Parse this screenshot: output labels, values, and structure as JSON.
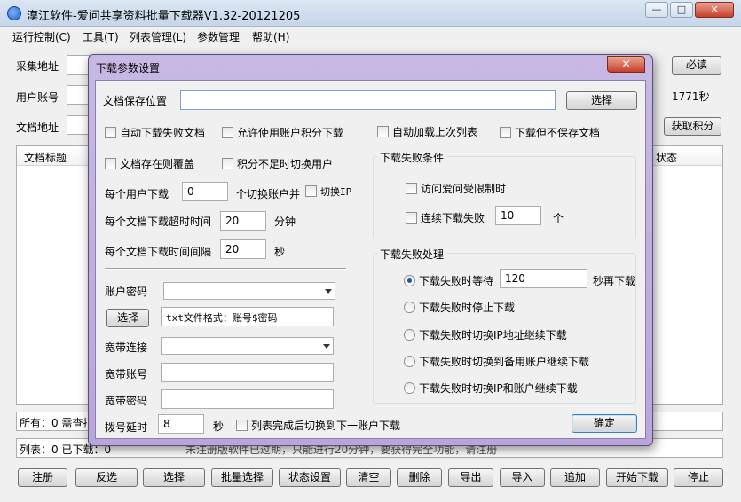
{
  "window": {
    "title": "漠江软件-爱问共享资料批量下载器V1.32-20121205",
    "controls": [
      "—",
      "□",
      "✕"
    ]
  },
  "menu": [
    "运行控制(C)",
    "工具(T)",
    "列表管理(L)",
    "参数管理",
    "帮助(H)"
  ],
  "main": {
    "collect_label": "采集地址",
    "must_read_button": "必读",
    "account_label": "用户账号",
    "points_value": "1771秒",
    "doc_url_label": "文档地址",
    "get_points_button": "获取积分",
    "table_header_title": "文档标题",
    "table_header_status": "状态",
    "status_all": "所有：0 需查拉",
    "status_list": "列表：0 已下载：0",
    "status_notice": "未注册版软件已过期，只能进行20分钟，要获得完全功能，请注册"
  },
  "buttons": [
    "注册",
    "反选",
    "选择",
    "批量选择",
    "状态设置",
    "清空",
    "删除",
    "导出",
    "导入",
    "追加",
    "开始下载",
    "停止"
  ],
  "dialog": {
    "title": "下载参数设置",
    "close_symbol": "✕",
    "save_location_label": "文档保存位置",
    "save_location_value": "",
    "select_button": "选择",
    "checks": {
      "auto_fail": "自动下载失败文档",
      "allow_points": "允许使用账户积分下载",
      "auto_load": "自动加载上次列表",
      "no_save": "下载但不保存文档",
      "overwrite": "文档存在则覆盖",
      "switch_user": "积分不足时切换用户",
      "switch_ip": "切换IP",
      "after_list": "列表完成后切换到下一账户下载"
    },
    "per_user_label": "每个用户下载",
    "per_user_value": "0",
    "per_user_suffix": "个切换账户并",
    "timeout_label": "每个文档下载超时时间",
    "timeout_value": "20",
    "timeout_unit": "分钟",
    "interval_label": "每个文档下载时间间隔",
    "interval_value": "20",
    "interval_unit": "秒",
    "account_pwd_label": "账户密码",
    "select2_button": "选择",
    "txt_format": "txt文件格式：账号$密码",
    "broadband_conn_label": "宽带连接",
    "broadband_account_label": "宽带账号",
    "broadband_pwd_label": "宽带密码",
    "dial_delay_label": "拨号延时",
    "dial_delay_value": "8",
    "dial_delay_unit": "秒",
    "fail_cond": {
      "title": "下载失败条件",
      "limited": "访问爱问受限制时",
      "consecutive": "连续下载失败",
      "consecutive_value": "10",
      "consecutive_unit": "个"
    },
    "fail_handle": {
      "title": "下载失败处理",
      "wait": "下载失败时等待",
      "wait_value": "120",
      "wait_suffix": "秒再下载",
      "stop": "下载失败时停止下载",
      "switch_ip": "下载失败时切换IP地址继续下载",
      "switch_backup": "下载失败时切换到备用账户继续下载",
      "switch_both": "下载失败时切换IP和账户继续下载"
    },
    "ok_button": "确定"
  }
}
